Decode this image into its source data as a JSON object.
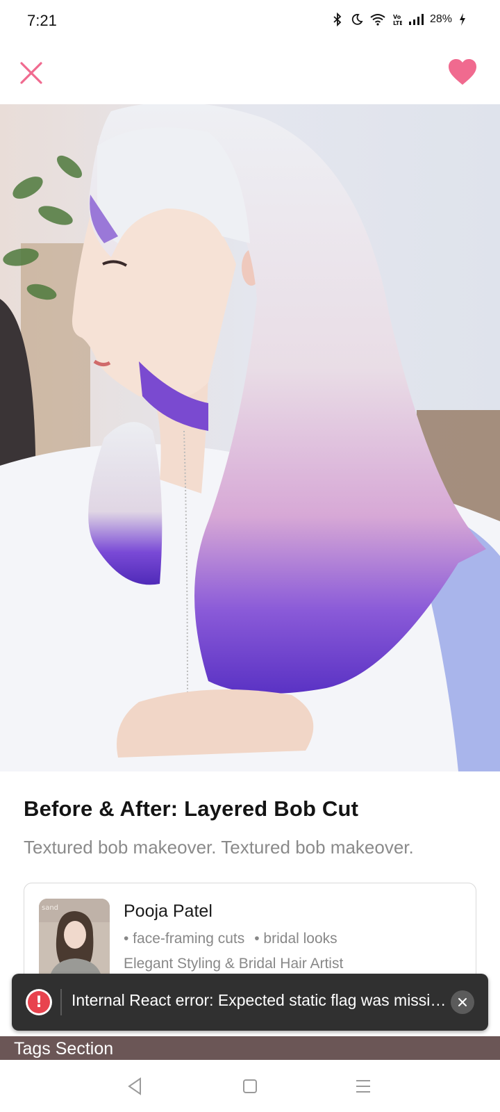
{
  "status_bar": {
    "time": "7:21",
    "battery": "28%",
    "icons": [
      "bluetooth-icon",
      "moon-icon",
      "wifi-icon",
      "volte-icon",
      "signal-icon",
      "battery-charging-icon"
    ]
  },
  "header": {
    "close_icon": "close-icon",
    "favorite_icon": "heart-icon",
    "accent_color": "#f06a8f"
  },
  "post": {
    "title": "Before & After: Layered Bob Cut",
    "description": "Textured bob makeover. Textured bob makeover."
  },
  "artist": {
    "name": "Pooja Patel",
    "tags": [
      "• face-framing cuts",
      "• bridal looks"
    ],
    "role": "Elegant Styling & Bridal Hair Artist",
    "avatar_watermark": "sand"
  },
  "toast": {
    "message": "Internal React error: Expected static flag was missing. Please notify the React team.",
    "error_color": "#e8434e"
  },
  "tags_section": {
    "label": "Tags Section"
  },
  "nav": {
    "back_icon": "back-triangle-icon",
    "home_icon": "home-square-icon",
    "menu_icon": "menu-lines-icon"
  }
}
